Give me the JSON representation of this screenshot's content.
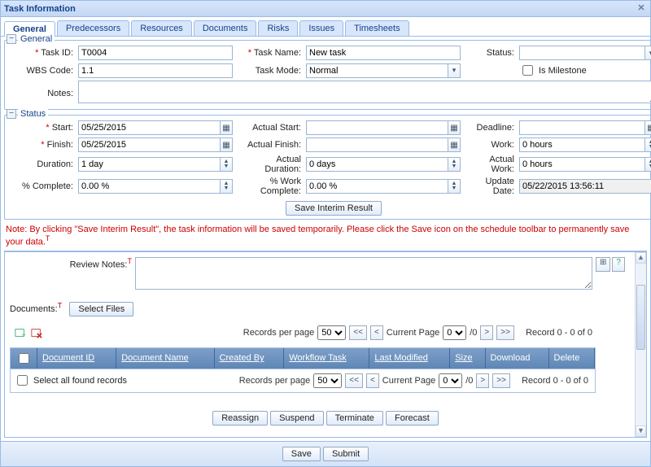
{
  "window": {
    "title": "Task Information"
  },
  "tabs": {
    "t0": "General",
    "t1": "Predecessors",
    "t2": "Resources",
    "t3": "Documents",
    "t4": "Risks",
    "t5": "Issues",
    "t6": "Timesheets"
  },
  "groups": {
    "general": "General",
    "status": "Status"
  },
  "labels": {
    "task_id": "Task ID:",
    "wbs_code": "WBS Code:",
    "notes": "Notes:",
    "task_name": "Task Name:",
    "task_mode": "Task Mode:",
    "status": "Status:",
    "is_milestone": "Is Milestone",
    "start": "Start:",
    "finish": "Finish:",
    "duration": "Duration:",
    "pct_complete": "% Complete:",
    "actual_start": "Actual Start:",
    "actual_finish": "Actual Finish:",
    "actual_duration": "Actual Duration:",
    "pct_work_complete": "% Work Complete:",
    "deadline": "Deadline:",
    "work": "Work:",
    "actual_work": "Actual Work:",
    "update_date": "Update Date:",
    "review_notes": "Review Notes:",
    "documents": "Documents:",
    "select_files": "Select Files",
    "records_per_page": "Records per page",
    "current_page": "Current Page",
    "record_of": "Record 0 - 0 of 0",
    "per_page_suffix": "/0",
    "select_all": "Select all found records"
  },
  "values": {
    "task_id": "T0004",
    "wbs_code": "1.1",
    "task_name": "New task",
    "task_mode": "Normal",
    "status": "",
    "start": "05/25/2015",
    "finish": "05/25/2015",
    "duration": "1 day",
    "pct_complete": "0.00 %",
    "actual_start": "",
    "actual_finish": "",
    "actual_duration": "0 days",
    "pct_work_complete": "0.00 %",
    "deadline": "",
    "work": "0 hours",
    "actual_work": "0 hours",
    "update_date": "05/22/2015 13:56:11",
    "per_page": "50",
    "cur_page": "0"
  },
  "columns": {
    "doc_id": "Document ID",
    "doc_name": "Document Name",
    "created_by": "Created By",
    "workflow_task": "Workflow Task",
    "last_modified": "Last Modified",
    "size": "Size",
    "download": "Download",
    "delete": "Delete"
  },
  "buttons": {
    "save_interim": "Save Interim Result",
    "reassign": "Reassign",
    "suspend": "Suspend",
    "terminate": "Terminate",
    "forecast": "Forecast",
    "save": "Save",
    "submit": "Submit"
  },
  "note": "Note: By clicking \"Save Interim Result\", the task information will be saved temporarily. Please click the Save icon on the schedule toolbar to permanently save your data."
}
